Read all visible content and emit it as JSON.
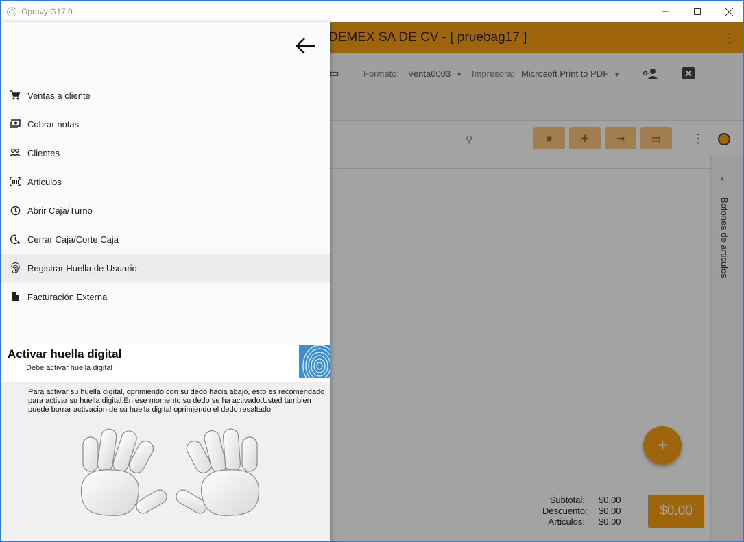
{
  "window": {
    "title": "Opravy G17.0",
    "minimize_glyph": "—",
    "maximize_glyph": "☐",
    "close_glyph": "✕"
  },
  "app": {
    "company_title": "DEMEX SA DE CV - [ pruebag17 ]",
    "toolbar": {
      "formato_label": "Formato:",
      "formato_value": "Venta0003",
      "impresora_label": "Impresora:",
      "impresora_value": "Microsoft Print to PDF"
    },
    "side_panel_label": "Botones de articulos",
    "fab_label": "+",
    "totals": {
      "subtotal_label": "Subtotal:",
      "subtotal_value": "$0.00",
      "descuento_label": "Descuento:",
      "descuento_value": "$0.00",
      "articulos_label": "Articulos:",
      "articulos_value": "$0.00",
      "total_button": "$0.00"
    },
    "accent_color": "#f39c12"
  },
  "drawer": {
    "menu": [
      {
        "label": "Ventas a cliente",
        "icon": "cart-icon"
      },
      {
        "label": "Cobrar notas",
        "icon": "money-icon"
      },
      {
        "label": "Clientes",
        "icon": "people-icon"
      },
      {
        "label": "Articulos",
        "icon": "barcode-icon"
      },
      {
        "label": "Abrir Caja/Turno",
        "icon": "clock-icon"
      },
      {
        "label": "Cerrar Caja/Corte Caja",
        "icon": "clock-off-icon"
      },
      {
        "label": "Registrar Huella de Usuario",
        "icon": "fingerprint-icon"
      },
      {
        "label": "Facturación Externa",
        "icon": "document-icon"
      }
    ],
    "active_index": 6
  },
  "fingerprint": {
    "title": "Activar huella digital",
    "subtitle": "Debe activar huella digital",
    "description": "Para activar su huella digital, oprimiendo con su dedo hacia abajo, esto es recomendado para activar su huella digital.En ese momento su dedo se ha activado.Usted tambien puede borrar activacion de su huella digital oprimiendo el dedo resaltado"
  }
}
